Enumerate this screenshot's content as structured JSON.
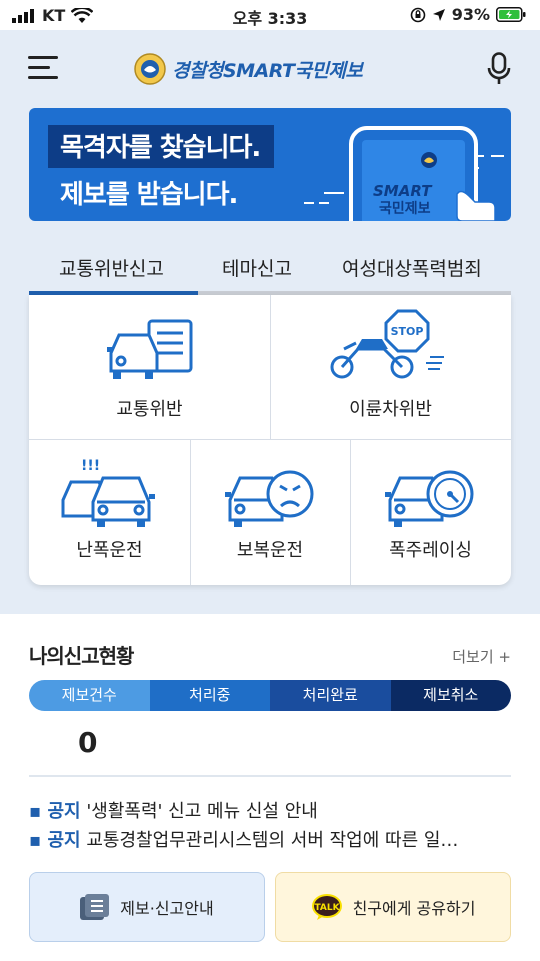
{
  "status": {
    "carrier": "KT",
    "time": "오후 3:33",
    "battery": "93%"
  },
  "header": {
    "logo_text": "경찰청SMART국민제보"
  },
  "banner": {
    "line1": "목격자를 찾습니다.",
    "line2": "제보를 받습니다.",
    "phone_text1": "SMART",
    "phone_text2": "국민제보"
  },
  "tabs": [
    {
      "label": "교통위반신고"
    },
    {
      "label": "테마신고"
    },
    {
      "label": "여성대상폭력범죄"
    }
  ],
  "categories": [
    {
      "label": "교통위반"
    },
    {
      "label": "이륜차위반"
    },
    {
      "label": "난폭운전"
    },
    {
      "label": "보복운전"
    },
    {
      "label": "폭주레이싱"
    }
  ],
  "stop_sign": "STOP",
  "my_reports": {
    "title": "나의신고현황",
    "more_label": "더보기 +",
    "segments": [
      {
        "label": "제보건수",
        "color": "#4d9be3"
      },
      {
        "label": "처리중",
        "color": "#1f6ec7"
      },
      {
        "label": "처리완료",
        "color": "#1a4d9e"
      },
      {
        "label": "제보취소",
        "color": "#0b2a63"
      }
    ],
    "count": "0"
  },
  "notices": [
    {
      "tag": "공지",
      "text": "'생활폭력' 신고 메뉴 신설 안내"
    },
    {
      "tag": "공지",
      "text": "교통경찰업무관리시스템의 서버 작업에 따른 일…"
    }
  ],
  "buttons": {
    "guide": "제보·신고안내",
    "share": "친구에게 공유하기",
    "talk_badge": "TALK"
  },
  "colors": {
    "primary": "#1f5fae",
    "banner": "#1e6fd0",
    "kakao": "#f9e000"
  }
}
